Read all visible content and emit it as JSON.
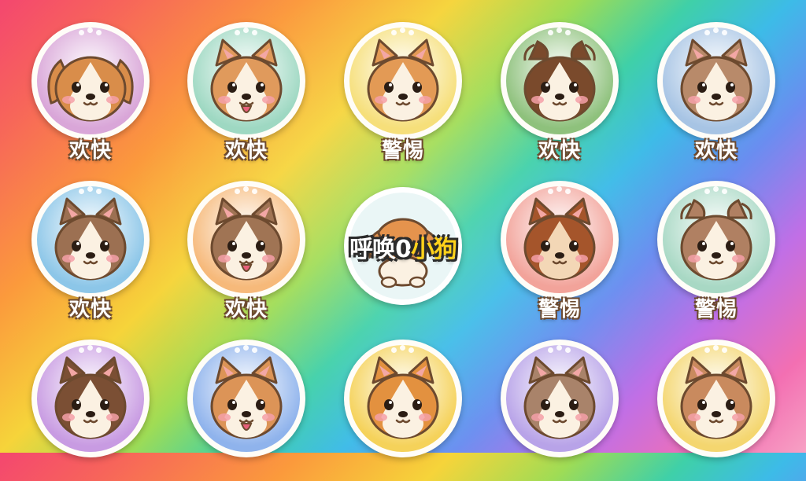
{
  "game": {
    "title_part1": "呼唤",
    "title_mark": "0",
    "title_part2": "小狗"
  },
  "colors": {
    "outline": "#6d4a2f",
    "highlight": "#ffd21a"
  },
  "tokens": [
    {
      "label": "欢快",
      "bg": "#d9a6d8",
      "fur": "#d98d4a",
      "face": "#fbf1e2",
      "ears": "floppy",
      "tongue": false
    },
    {
      "label": "欢快",
      "bg": "#9ed8c2",
      "fur": "#e09a5c",
      "face": "#fbf1e2",
      "ears": "pointy",
      "tongue": true
    },
    {
      "label": "警惕",
      "bg": "#f6df7a",
      "fur": "#e39a55",
      "face": "#fbf1e2",
      "ears": "pointy",
      "tongue": false
    },
    {
      "label": "欢快",
      "bg": "#8ec17c",
      "fur": "#7a4a2c",
      "face": "#fbf1e2",
      "ears": "fold",
      "tongue": false
    },
    {
      "label": "欢快",
      "bg": "#a7c4e4",
      "fur": "#b88a6a",
      "face": "#fbf1e2",
      "ears": "pointy",
      "tongue": false
    },
    {
      "label": "欢快",
      "bg": "#8cc6e8",
      "fur": "#9c7052",
      "face": "#fbf1e2",
      "ears": "pointy",
      "tongue": false
    },
    {
      "label": "欢快",
      "bg": "#f6b97a",
      "fur": "#a07454",
      "face": "#fbf1e2",
      "ears": "pointy",
      "tongue": true
    },
    {
      "label": "警惕",
      "bg": "#f2a39a",
      "fur": "#a5552b",
      "face": "#f3d7b6",
      "ears": "pointy",
      "tongue": false
    },
    {
      "label": "警惕",
      "bg": "#a8d8c4",
      "fur": "#b08062",
      "face": "#fbf1e2",
      "ears": "fold",
      "tongue": false
    },
    {
      "label": "",
      "bg": "#c89be2",
      "fur": "#7b4f34",
      "face": "#fbf1e2",
      "ears": "pointy",
      "tongue": false
    },
    {
      "label": "",
      "bg": "#8fb3ec",
      "fur": "#dc9457",
      "face": "#fbf1e2",
      "ears": "pointy",
      "tongue": true
    },
    {
      "label": "",
      "bg": "#f5d25a",
      "fur": "#e3913f",
      "face": "#fbf1e2",
      "ears": "pointy",
      "tongue": false
    },
    {
      "label": "",
      "bg": "#b8a3e8",
      "fur": "#a9836a",
      "face": "#fbf1e2",
      "ears": "pointy",
      "tongue": false
    },
    {
      "label": "",
      "bg": "#f4d66f",
      "fur": "#c98a5e",
      "face": "#fbf1e2",
      "ears": "pointy",
      "tongue": false
    }
  ]
}
